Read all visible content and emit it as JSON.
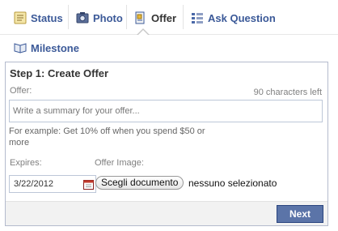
{
  "tabs": {
    "status": "Status",
    "photo": "Photo",
    "offer": "Offer",
    "ask_question": "Ask Question",
    "milestone": "Milestone",
    "selected": "Offer"
  },
  "offer_panel": {
    "title": "Step 1: Create Offer",
    "offer_label": "Offer:",
    "chars_left": "90 characters left",
    "offer_placeholder": "Write a summary for your offer...",
    "hint": "For example: Get 10% off when you spend $50 or more",
    "expires_label": "Expires:",
    "expires_value": "3/22/2012",
    "image_label": "Offer Image:",
    "file_button": "Scegli documento",
    "file_status": "nessuno selezionato",
    "next_button": "Next"
  },
  "colors": {
    "link": "#3b5998",
    "button": "#5b74a8",
    "border": "#bdc7d8"
  },
  "icons": [
    "status-icon",
    "photo-icon",
    "offer-icon",
    "question-icon",
    "milestone-icon",
    "calendar-icon"
  ]
}
